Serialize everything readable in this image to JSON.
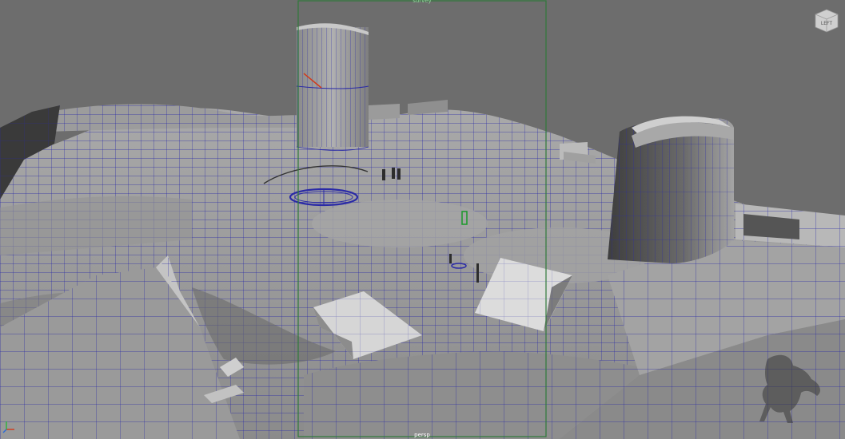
{
  "viewport": {
    "camera_name": "persp",
    "camera_top_label": "survey",
    "viewcube_face": "LEFT",
    "axis_icon": "xyz-axis-icon",
    "watermark_icon": "maya-horse-watermark-icon",
    "colors": {
      "background": "#6d6d6d",
      "wireframe": "#2a2aa6",
      "resolution_gate": "#2f7a3a",
      "selection_green": "#1a9a2a",
      "manipulator_red": "#d23a1a"
    }
  }
}
